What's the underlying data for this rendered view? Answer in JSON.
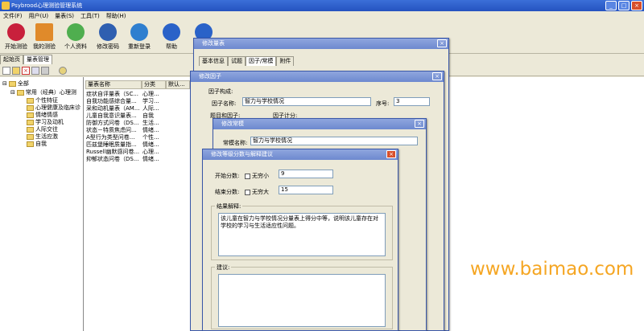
{
  "app": {
    "title": "Psybrood心理测验管理系统"
  },
  "menu": [
    "文件(F)",
    "用户(U)",
    "量表(S)",
    "工具(T)",
    "帮助(H)"
  ],
  "toolbar": [
    {
      "label": "开始测验",
      "icon": "heart-icon",
      "color": "#c8203c"
    },
    {
      "label": "我的测验",
      "icon": "house-icon",
      "color": "#e08a2a"
    },
    {
      "label": "个人资料",
      "icon": "chat-bubble-icon",
      "color": "#4fae4f"
    },
    {
      "label": "修改密码",
      "icon": "user-key-icon",
      "color": "#2f5fb0"
    },
    {
      "label": "重新登录",
      "icon": "refresh-icon",
      "color": "#2f7fcf"
    },
    {
      "label": "帮助",
      "icon": "help-icon",
      "color": "#2a62c8"
    },
    {
      "label": "",
      "icon": "info-icon",
      "color": "#2a62c8"
    }
  ],
  "tabs": [
    "起始页",
    "量表管理"
  ],
  "tree": {
    "root": "全部",
    "group": "常用（经典）心理测",
    "items": [
      "个性特征",
      "心理健康及临床诊",
      "情绪情感",
      "学习及动机",
      "人际交往",
      "生活应激",
      "自我"
    ]
  },
  "grid": {
    "columns": [
      "量表名称",
      "分类",
      "默认..."
    ],
    "rows": [
      [
        "症状自评量表（SC...",
        "心理...",
        ""
      ],
      [
        "自我功能感综合量...",
        "学习...",
        ""
      ],
      [
        "采和动机量表（AM...",
        "人际...",
        ""
      ],
      [
        "儿童自我意识量表...",
        "自我",
        ""
      ],
      [
        "防御方式问卷（DS...",
        "生活...",
        ""
      ],
      [
        "状态－特质焦虑问...",
        "情绪...",
        ""
      ],
      [
        "A型行为类型问卷...",
        "个性...",
        ""
      ],
      [
        "匹兹堡睡眠质量指...",
        "情绪...",
        ""
      ],
      [
        "Russell幽默感问卷...",
        "心理...",
        ""
      ],
      [
        "抑郁状态问卷（DS...",
        "情绪...",
        ""
      ]
    ]
  },
  "dlg_scale": {
    "title": "修改量表",
    "tabs": [
      "基本信息",
      "试题",
      "因子/常模",
      "附件"
    ]
  },
  "dlg_factor": {
    "title": "修改因子",
    "section": "因子构成:",
    "name_label": "因子名称:",
    "name_value": "智力与学校情况",
    "order_label": "序号:",
    "order_value": "3",
    "items_label": "题目和因子:",
    "calc_label": "因子计分:",
    "button_label": "择"
  },
  "dlg_norm": {
    "title": "修改常模",
    "name_label": "常模名称:",
    "name_value": "智力与学校情况"
  },
  "dlg_advice": {
    "title": "修改等级分数与解释建议",
    "start_label": "开始分数:",
    "start_check": "无穷小",
    "start_value": "9",
    "end_label": "结束分数:",
    "end_check": "无穷大",
    "end_value": "15",
    "result_label": "结果解释:",
    "result_text": "该儿童在智力与学校情况分量表上得分中等，说明该儿童存在对学校的学习与生活适应性问题。",
    "advice_label": "建议:",
    "advice_text": ""
  },
  "watermark": "www.baimao.com"
}
